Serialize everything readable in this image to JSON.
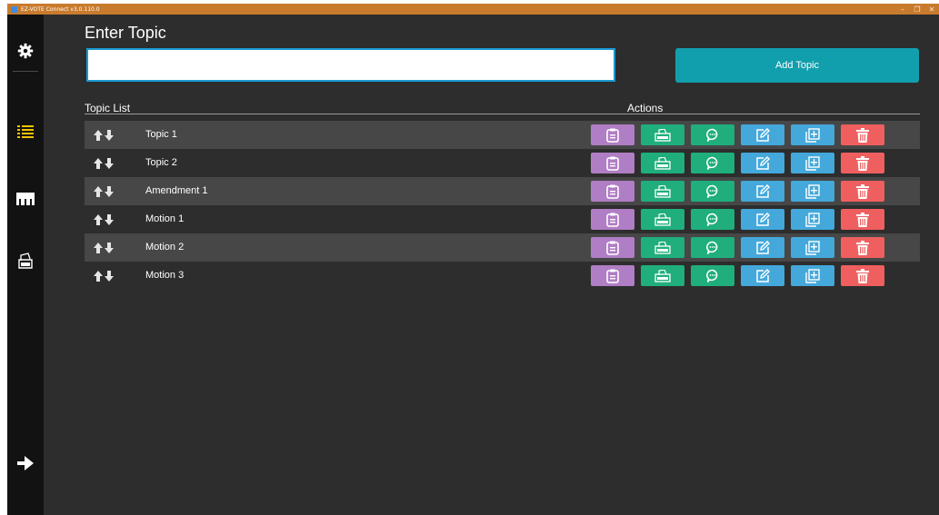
{
  "window": {
    "title": "EZ-VOTE Connect v3.0.110.0",
    "minimize_glyph": "–",
    "restore_glyph": "❐",
    "close_glyph": "✕"
  },
  "sidebar": {
    "items": [
      {
        "icon": "gear-icon",
        "active": false
      },
      {
        "icon": "list-icon",
        "active": true,
        "active_color": "#f2c200"
      },
      {
        "icon": "meeting-room-icon",
        "active": false
      },
      {
        "icon": "ballot-box-icon",
        "active": false
      }
    ],
    "exit_icon": "arrow-right-icon"
  },
  "header": {
    "title": "Enter Topic"
  },
  "topic_input": {
    "value": "",
    "placeholder": ""
  },
  "add_topic_button": {
    "label": "Add Topic",
    "color": "#119fad"
  },
  "topic_list": {
    "column_topic": "Topic List",
    "column_actions": "Actions",
    "rows": [
      {
        "name": "Topic 1"
      },
      {
        "name": "Topic 2"
      },
      {
        "name": "Amendment 1"
      },
      {
        "name": "Motion 1"
      },
      {
        "name": "Motion 2"
      },
      {
        "name": "Motion 3"
      }
    ],
    "actions": [
      {
        "icon": "clipboard-icon",
        "color": "#b07ec4"
      },
      {
        "icon": "vote-box-icon",
        "color": "#1fae7c"
      },
      {
        "icon": "chat-bubble-icon",
        "color": "#1fae7c"
      },
      {
        "icon": "edit-icon",
        "color": "#44a8da"
      },
      {
        "icon": "add-amendment-icon",
        "color": "#44a8da"
      },
      {
        "icon": "trash-icon",
        "color": "#ef5f5f"
      }
    ]
  }
}
